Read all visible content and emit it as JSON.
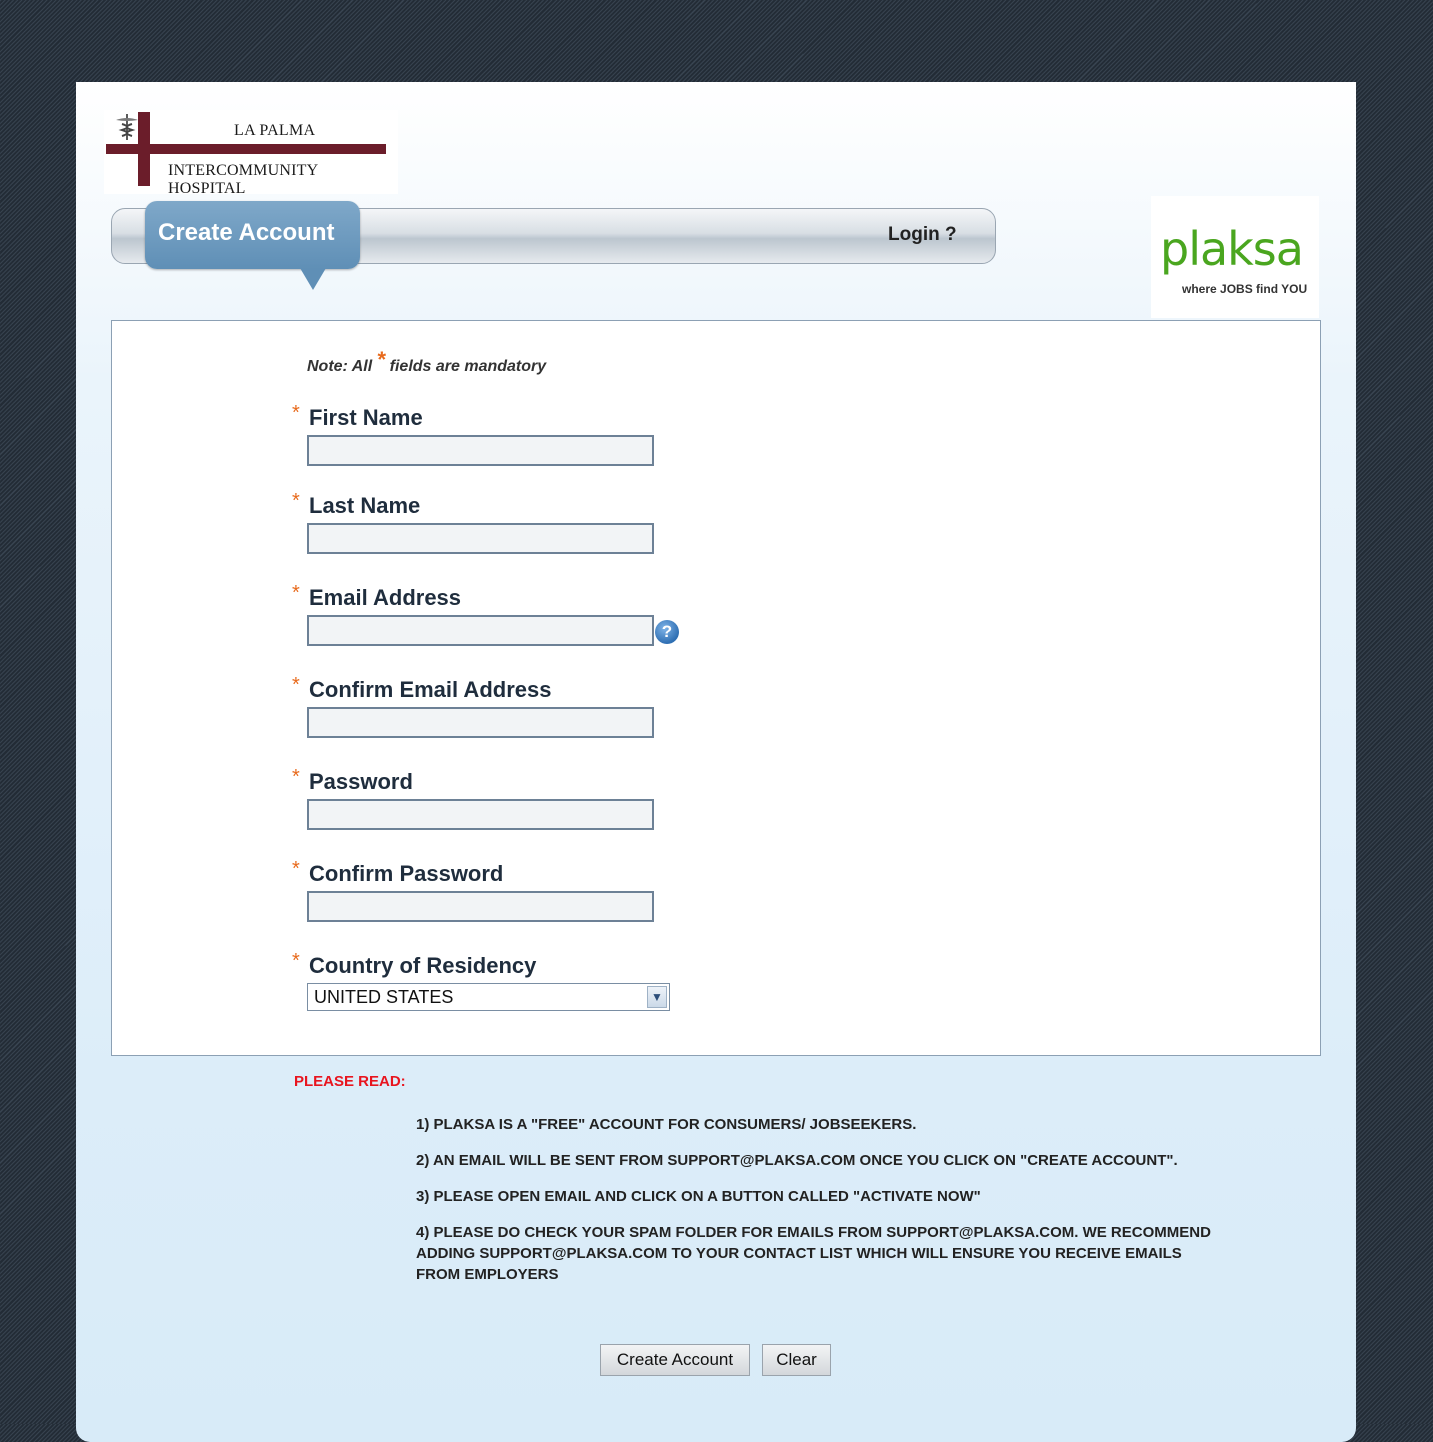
{
  "header": {
    "hospital_line1": "LA PALMA",
    "hospital_line2": "INTERCOMMUNITY HOSPITAL",
    "tab_create": "Create Account",
    "login_link": "Login ?",
    "brand_name": "plaksa",
    "brand_tagline": "where JOBS find YOU"
  },
  "form": {
    "note_before": "Note: All",
    "note_star": "*",
    "note_after": " fields are mandatory",
    "required_mark": "*",
    "fields": [
      {
        "label": "First Name",
        "value": ""
      },
      {
        "label": "Last Name",
        "value": ""
      },
      {
        "label": "Email Address",
        "value": ""
      },
      {
        "label": "Confirm Email Address",
        "value": ""
      },
      {
        "label": "Password",
        "value": ""
      },
      {
        "label": "Confirm Password",
        "value": ""
      }
    ],
    "help_icon": "?",
    "country_label": "Country of Residency",
    "country_value": "UNITED STATES",
    "select_arrow": "▼"
  },
  "notice": {
    "heading": "PLEASE READ:",
    "items": [
      "1) PLAKSA IS A \"FREE\" ACCOUNT FOR CONSUMERS/ JOBSEEKERS.",
      "2) AN EMAIL WILL BE SENT FROM SUPPORT@PLAKSA.COM ONCE YOU CLICK ON \"CREATE ACCOUNT\".",
      "3) PLEASE OPEN EMAIL AND CLICK ON A BUTTON CALLED \"ACTIVATE NOW\"",
      "4) PLEASE DO CHECK YOUR SPAM FOLDER FOR EMAILS FROM SUPPORT@PLAKSA.COM. WE RECOMMEND ADDING SUPPORT@PLAKSA.COM TO YOUR CONTACT LIST WHICH WILL ENSURE YOU RECEIVE EMAILS FROM EMPLOYERS"
    ]
  },
  "buttons": {
    "create": "Create Account",
    "clear": "Clear"
  },
  "colors": {
    "background": "#2a3440",
    "tab_blue": "#5f8fb6",
    "hospital_maroon": "#6b1d2a",
    "brand_green": "#4aa61f",
    "required_orange": "#e86a1c",
    "alert_red": "#e8151f"
  }
}
